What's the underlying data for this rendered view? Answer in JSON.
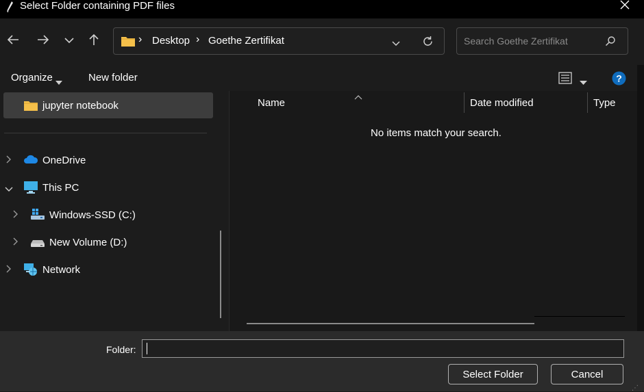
{
  "window": {
    "title": "Select Folder containing PDF files",
    "close_icon": "close-icon"
  },
  "nav": {
    "back_icon": "arrow-left-icon",
    "forward_icon": "arrow-right-icon",
    "recent_icon": "chevron-down-icon",
    "up_icon": "arrow-up-icon"
  },
  "address": {
    "crumbs": [
      "Desktop",
      "Goethe Zertifikat"
    ],
    "refresh_icon": "refresh-icon"
  },
  "search": {
    "placeholder": "Search Goethe Zertifikat",
    "value": ""
  },
  "toolbar": {
    "organize": "Organize",
    "new_folder": "New folder",
    "view_icon": "view-list-icon",
    "help_icon": "help-icon"
  },
  "sidebar": {
    "quick_item": "jupyter notebook",
    "items": [
      {
        "label": "OneDrive",
        "expanded": false
      },
      {
        "label": "This PC",
        "expanded": true
      },
      {
        "label": "Windows-SSD (C:)",
        "expanded": false
      },
      {
        "label": "New Volume (D:)",
        "expanded": false
      },
      {
        "label": "Network",
        "expanded": false
      }
    ]
  },
  "files": {
    "columns": [
      "Name",
      "Date modified",
      "Type"
    ],
    "empty_message": "No items match your search."
  },
  "footer": {
    "folder_label": "Folder:",
    "folder_value": "",
    "select_button": "Select Folder",
    "cancel_button": "Cancel"
  },
  "colors": {
    "accent_blue": "#0f6cbd",
    "folder_yellow": "#f5c04a",
    "background": "#191919"
  }
}
